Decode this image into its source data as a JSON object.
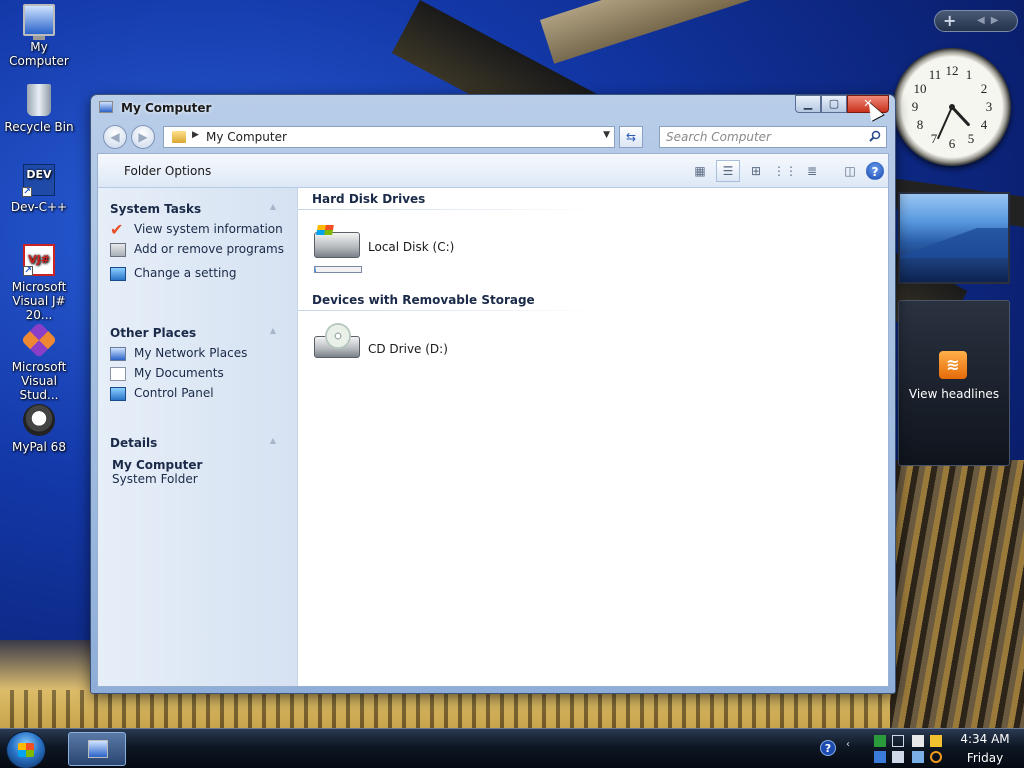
{
  "desktop": {
    "icons": [
      {
        "label": "My Computer",
        "icon": "computer-icon"
      },
      {
        "label": "Recycle Bin",
        "icon": "recycle-bin-icon"
      },
      {
        "label": "Dev-C++",
        "icon": "dev-cpp-icon"
      },
      {
        "label": "Microsoft Visual J# 20...",
        "icon": "visual-jsharp-icon"
      },
      {
        "label": "Microsoft Visual Stud...",
        "icon": "visual-studio-icon"
      },
      {
        "label": "MyPal 68",
        "icon": "mypal-icon"
      }
    ]
  },
  "sidebar": {
    "add_label": "+",
    "clock": {
      "hour": 4,
      "minute": 34
    },
    "feed_label": "View headlines"
  },
  "window": {
    "title": "My Computer",
    "address": "My Computer",
    "search_placeholder": "Search Computer",
    "command_bar": {
      "folder_options": "Folder Options"
    },
    "task_pane": {
      "system_tasks": {
        "title": "System Tasks",
        "items": [
          "View system information",
          "Add or remove programs",
          "Change a setting"
        ]
      },
      "other_places": {
        "title": "Other Places",
        "items": [
          "My Network Places",
          "My Documents",
          "Control Panel"
        ]
      },
      "details": {
        "title": "Details",
        "name": "My Computer",
        "type": "System Folder"
      }
    },
    "groups": [
      {
        "title": "Hard Disk Drives",
        "items": [
          {
            "label": "Local Disk (C:)",
            "usage": 0.03
          }
        ]
      },
      {
        "title": "Devices with Removable Storage",
        "items": [
          {
            "label": "CD Drive (D:)"
          }
        ]
      }
    ]
  },
  "taskbar": {
    "tray": {
      "time": "4:34 AM",
      "day": "Friday"
    }
  },
  "colors": {
    "accent": "#2b63c9",
    "close_button": "#c8321c",
    "rss": "#e56a08"
  }
}
